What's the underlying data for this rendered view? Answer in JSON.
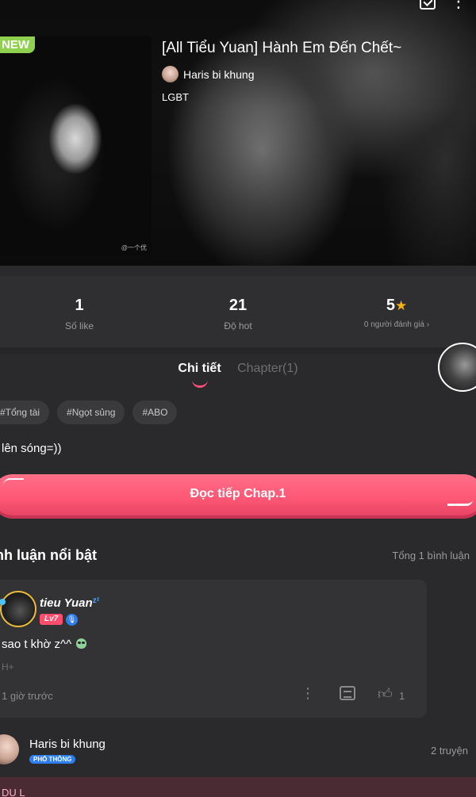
{
  "story": {
    "badge": "NEW",
    "title": "[All Tiểu Yuan] Hành Em Đến Chết~",
    "author": "Haris bi khung",
    "genre": "LGBT",
    "cover_watermark": "@一个优"
  },
  "stats": [
    {
      "value": "1",
      "label": "Số like"
    },
    {
      "value": "21",
      "label": "Độ hot"
    },
    {
      "value": "5",
      "label": "0 người đánh giá ›"
    }
  ],
  "tabs": {
    "details": "Chi tiết",
    "chapters": "Chapter(1)"
  },
  "tags": [
    "#Tổng tài",
    "#Ngọt sủng",
    "#ABO"
  ],
  "description": "lên sóng=))",
  "read_button": "Đọc tiếp Chap.1",
  "comments": {
    "title": "nh luận nổi bật",
    "total": "Tổng 1 bình luận",
    "items": [
      {
        "user": "tieu Yuan",
        "level": "Lv7",
        "text": "sao t khờ z^^",
        "sub": "H+",
        "time": "1 giờ trước",
        "likes": "1"
      }
    ]
  },
  "author_row": {
    "name": "Haris bi khung",
    "badge": "PHỔ THÔNG",
    "count": "2 truyện"
  },
  "bottom_bar": "DU L"
}
